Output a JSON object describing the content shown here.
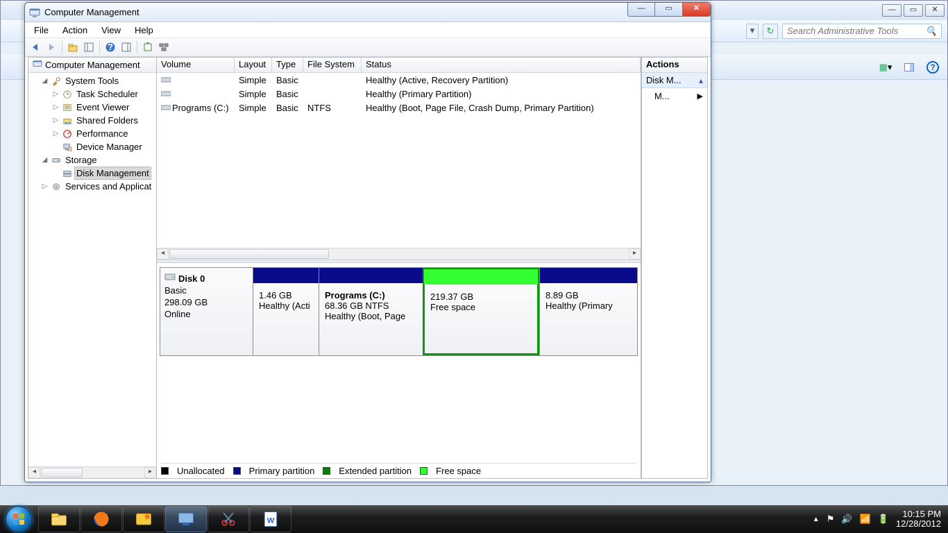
{
  "bg": {
    "search_placeholder": "Search Administrative Tools",
    "win_min": "—",
    "win_max": "▭",
    "win_close": "✕"
  },
  "mmc": {
    "title": "Computer Management",
    "win_min": "—",
    "win_max": "▭",
    "win_close": "✕",
    "menu": {
      "file": "File",
      "action": "Action",
      "view": "View",
      "help": "Help"
    }
  },
  "tree": {
    "root": "Computer Management",
    "system_tools": "System Tools",
    "task_scheduler": "Task Scheduler",
    "event_viewer": "Event Viewer",
    "shared_folders": "Shared Folders",
    "performance": "Performance",
    "device_manager": "Device Manager",
    "storage": "Storage",
    "disk_management": "Disk Management",
    "services": "Services and Applicat"
  },
  "volumes": {
    "headers": {
      "volume": "Volume",
      "layout": "Layout",
      "type": "Type",
      "fs": "File System",
      "status": "Status"
    },
    "rows": [
      {
        "name": "",
        "layout": "Simple",
        "type": "Basic",
        "fs": "",
        "status": "Healthy (Active, Recovery Partition)"
      },
      {
        "name": "",
        "layout": "Simple",
        "type": "Basic",
        "fs": "",
        "status": "Healthy (Primary Partition)"
      },
      {
        "name": "Programs (C:)",
        "layout": "Simple",
        "type": "Basic",
        "fs": "NTFS",
        "status": "Healthy (Boot, Page File, Crash Dump, Primary Partition)"
      }
    ]
  },
  "disk": {
    "name": "Disk 0",
    "type": "Basic",
    "size": "298.09 GB",
    "state": "Online",
    "parts": {
      "p0": {
        "name": "",
        "line1": "1.46 GB",
        "line2": "Healthy (Acti"
      },
      "p1": {
        "name": "Programs  (C:)",
        "line1": "68.36 GB NTFS",
        "line2": "Healthy (Boot, Page"
      },
      "p2": {
        "name": "",
        "line1": "219.37 GB",
        "line2": "Free space"
      },
      "p3": {
        "name": "",
        "line1": "8.89 GB",
        "line2": "Healthy (Primary"
      }
    }
  },
  "legend": {
    "unallocated": "Unallocated",
    "primary": "Primary partition",
    "extended": "Extended partition",
    "free": "Free space"
  },
  "actions": {
    "header": "Actions",
    "section": "Disk M...",
    "item": "M..."
  },
  "tray": {
    "time": "10:15 PM",
    "date": "12/28/2012"
  }
}
